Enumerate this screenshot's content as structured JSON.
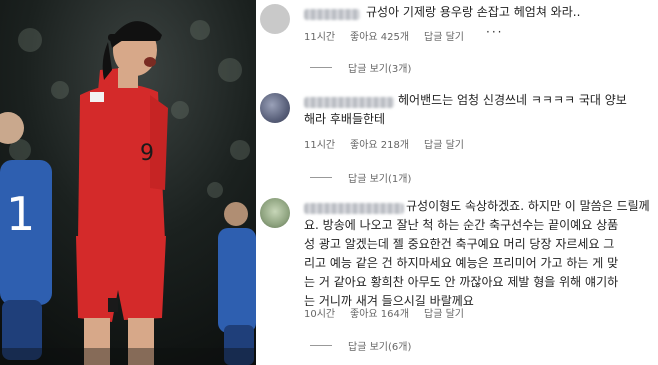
{
  "comments": [
    {
      "text_lines": [
        "규성아 기제랑 용우랑 손잡고 헤엄쳐 와라.."
      ],
      "time": "11시간",
      "likes": "좋아요 425개",
      "reply": "답글 달기",
      "more_icon": "ellipsis-icon",
      "more_label": "···",
      "view_replies": "답글 보기(3개)"
    },
    {
      "text_lines": [
        "헤어밴드는 엄청 신경쓰네 ㅋㅋㅋㅋ 국대 양보",
        "해라 후배들한테"
      ],
      "time": "11시간",
      "likes": "좋아요 218개",
      "reply": "답글 달기",
      "view_replies": "답글 보기(1개)"
    },
    {
      "text_lines": [
        "규성이형도 속상하겠죠. 하지만 이 말씀은 드릴께",
        "요. 방송에 나오고 잘난 척 하는 순간 축구선수는 끝이예요 상품",
        "성 광고 알겠는데 젤 중요한건 축구예요 머리 당장 자르세요 그",
        "리고 예능 같은 건 하지마세요 예능은 프리미어 가고 하는 게 맞",
        "는 거 같아요 황희찬 아무도 안 까잖아요 제발 형을 위해 얘기하",
        "는 거니까 새겨 들으시길 바랄께요"
      ],
      "time": "10시간",
      "likes": "좋아요 164개",
      "reply": "답글 달기",
      "view_replies": "답글 보기(6개)"
    }
  ],
  "photo": {
    "jersey_number": "9",
    "jersey_color": "#d42a2a",
    "opponent_color": "#2e5fb0"
  }
}
